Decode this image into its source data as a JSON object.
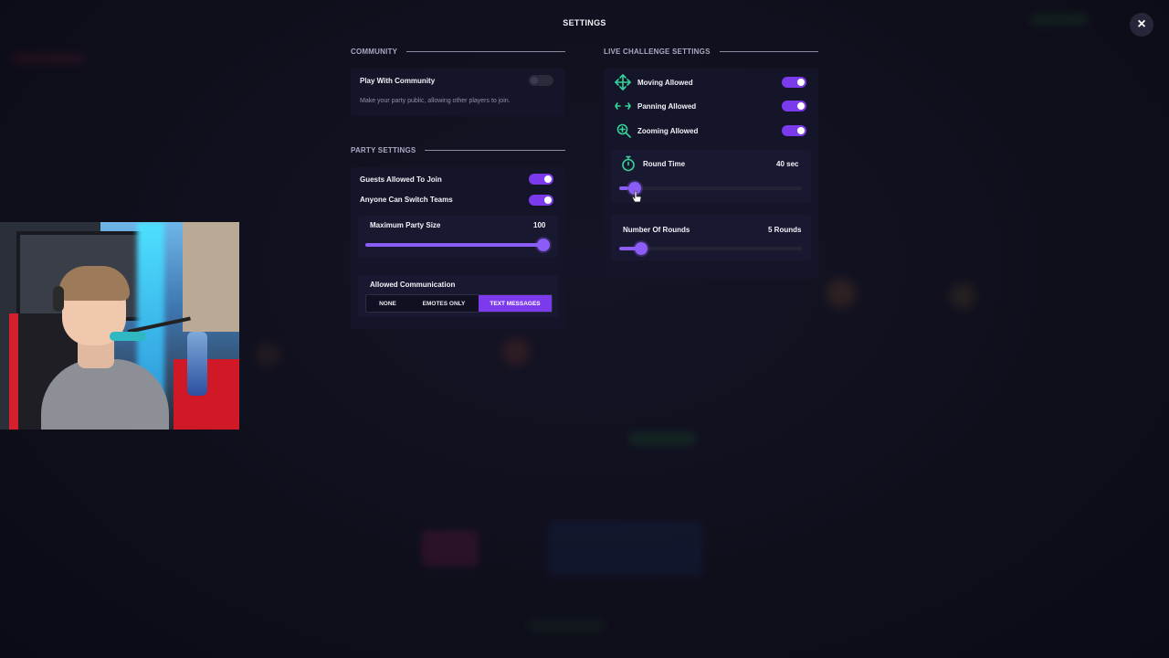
{
  "header": {
    "title": "SETTINGS",
    "close_label": "×"
  },
  "community": {
    "heading": "COMMUNITY",
    "play_label": "Play With Community",
    "play_enabled": false,
    "description": "Make your party public, allowing other players to join."
  },
  "party": {
    "heading": "PARTY SETTINGS",
    "guests_label": "Guests Allowed To Join",
    "guests_enabled": true,
    "switch_label": "Anyone Can Switch Teams",
    "switch_enabled": true,
    "max_size_label": "Maximum Party Size",
    "max_size_value": "100",
    "max_size_fraction": 1.0,
    "communication_label": "Allowed Communication",
    "communication_options": [
      "NONE",
      "EMOTES ONLY",
      "TEXT MESSAGES"
    ],
    "communication_selected": "TEXT MESSAGES"
  },
  "live": {
    "heading": "LIVE CHALLENGE SETTINGS",
    "moving_label": "Moving Allowed",
    "moving_enabled": true,
    "moving_icon": "move-arrows-icon",
    "panning_label": "Panning Allowed",
    "panning_enabled": true,
    "panning_icon": "pan-arrows-icon",
    "zooming_label": "Zooming Allowed",
    "zooming_enabled": true,
    "zooming_icon": "zoom-icon",
    "round_time_label": "Round Time",
    "round_time_value": "40 sec",
    "round_time_icon": "stopwatch-icon",
    "round_time_fraction": 0.05,
    "rounds_label": "Number Of Rounds",
    "rounds_value": "5 Rounds",
    "rounds_fraction": 0.1
  },
  "colors": {
    "accent": "#7c3aed",
    "icon_green": "#34d399",
    "panel": "#15152a",
    "background": "#0f0f1c"
  }
}
